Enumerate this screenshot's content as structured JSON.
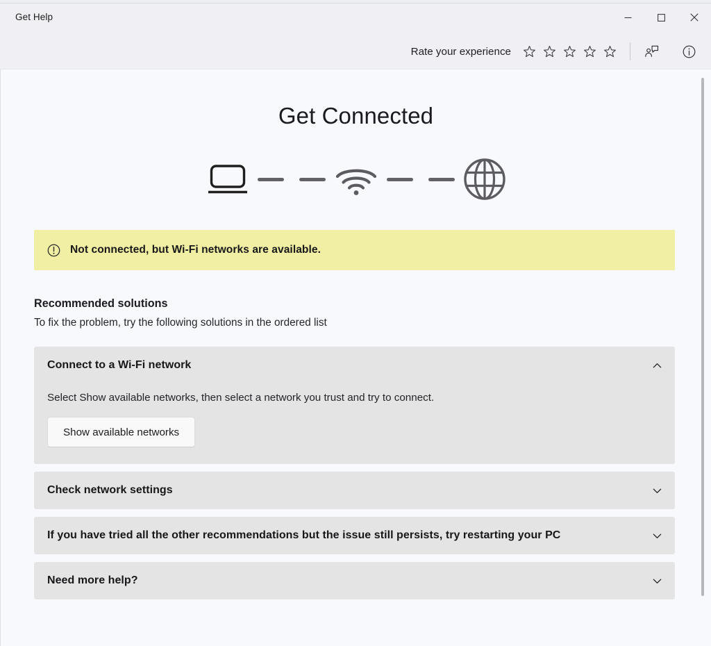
{
  "window": {
    "title": "Get Help",
    "controls": {
      "minimize_label": "Minimize",
      "maximize_label": "Maximize",
      "close_label": "Close"
    }
  },
  "titlebar": {
    "rating": {
      "label": "Rate your experience",
      "star_count": 5,
      "stars_filled": 0,
      "star_glyph": "☆"
    },
    "contact_support_icon": "person-speech-bubble-icon",
    "info_icon": "info-circle-icon"
  },
  "main": {
    "heading": "Get Connected",
    "diagram": {
      "nodes": [
        "laptop-icon",
        "wifi-icon",
        "globe-icon"
      ],
      "connector": "dashed-line"
    },
    "banner": {
      "icon": "exclamation-circle-icon",
      "text": "Not connected, but Wi-Fi networks are available.",
      "background_color": "#f1efa3"
    },
    "recommended": {
      "heading": "Recommended solutions",
      "subtext": "To fix the problem, try the following solutions in the ordered list"
    },
    "accordions": [
      {
        "title": "Connect to a Wi-Fi network",
        "expanded": true,
        "chevron": "chevron-up-icon",
        "description": "Select Show available networks, then select a network you trust and try to connect.",
        "button_label": "Show available networks"
      },
      {
        "title": "Check network settings",
        "expanded": false,
        "chevron": "chevron-down-icon"
      },
      {
        "title": "If you have tried all the other recommendations but the issue still persists, try restarting your PC",
        "expanded": false,
        "chevron": "chevron-down-icon"
      },
      {
        "title": "Need more help?",
        "expanded": false,
        "chevron": "chevron-down-icon"
      }
    ]
  },
  "colors": {
    "titlebar_bg": "#f0f0f4",
    "content_bg": "#f8f9fc",
    "accordion_bg": "#e4e4e4",
    "banner_bg": "#f1efa3",
    "icon_dark": "#1f1f1f",
    "icon_gray": "#5c5c60"
  }
}
